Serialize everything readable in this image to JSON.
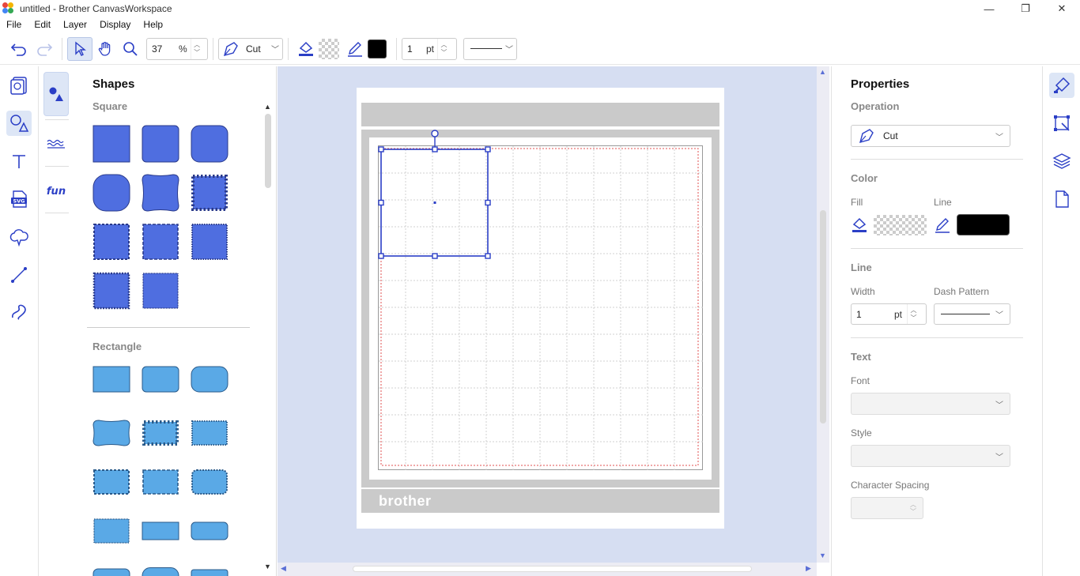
{
  "window": {
    "title": "untitled - Brother CanvasWorkspace",
    "minimize": "—",
    "maximize": "❐",
    "close": "✕"
  },
  "menu": [
    "File",
    "Edit",
    "Layer",
    "Display",
    "Help"
  ],
  "toolbar": {
    "zoom_value": "37",
    "zoom_unit": "%",
    "operation": "Cut",
    "line_width": "1",
    "line_width_unit": "pt"
  },
  "colors": {
    "accent": "#2b3fc6",
    "square_fill": "#4f6ee0",
    "rect_fill": "#5aa9e6",
    "mat_band": "#cacaca",
    "canvas_bg": "#d6def2",
    "cut_line": "#e05050",
    "line_color": "#000000"
  },
  "shapes_panel": {
    "title": "Shapes",
    "section_square": "Square",
    "section_rectangle": "Rectangle",
    "categories": [
      "shapes-icon",
      "wave-border-icon",
      "fun-text-icon"
    ]
  },
  "mat": {
    "brand": "brother"
  },
  "properties": {
    "title": "Properties",
    "operation_label": "Operation",
    "operation_value": "Cut",
    "color_label": "Color",
    "fill_label": "Fill",
    "line_label": "Line",
    "line_section": "Line",
    "width_label": "Width",
    "width_value": "1",
    "width_unit": "pt",
    "dash_label": "Dash Pattern",
    "text_section": "Text",
    "font_label": "Font",
    "style_label": "Style",
    "char_spacing_label": "Character Spacing"
  }
}
